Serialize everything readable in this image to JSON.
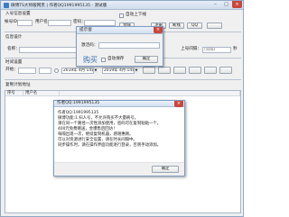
{
  "window": {
    "title": "微博TS大师版网页 | 作者QQ1991995135 - 测试版",
    "minimize": "–",
    "maximize": "□",
    "close": "×"
  },
  "account": {
    "group_label": "入号信息设置",
    "acc_label": "帐号ID：",
    "user_label": "用户名：",
    "pwd_label": "密码：",
    "checkbox_label": "自动上下线",
    "login_button": "登陆",
    "register_button": "注册",
    "lower_button": "断线",
    "qq_button": "QQ"
  },
  "config": {
    "group_label": "信息设计",
    "name_label": "名称：",
    "line_value": "",
    "upper_limit_label": "上号间隔：",
    "upper_limit_value": "(间隔)",
    "seconds_label": "秒"
  },
  "time": {
    "group_label": "时间设置",
    "start_label": "开始：",
    "start_value": "2019年 4月 14日",
    "end_value": "2019年 4月 14日",
    "radio_label": "任务"
  },
  "list": {
    "group_label": "复制计划地址",
    "columns": [
      "序号",
      "用户名"
    ]
  },
  "popup": {
    "title": "提示窗",
    "field_label": "激活码：",
    "button_label": "确定",
    "checkbox_label": "自动保存",
    "brand_text": "购买"
  },
  "message": {
    "title": "作者QQ:1991995135",
    "lines": [
      "作者QQ:1991995135",
      "微博功能:1.扫人号，不允许购买不大量刷号。",
      "请在同一个路径一次性添加使用，密码可在复制粘贴一个。",
      "400元免费赠送，金爆售后回访！",
      "每隔出现一次，继续复制机器，感谢惠顾。",
      "可以对资源进行安全设置，请在时长间隔中。",
      "同步操作时，请在操作界面功能进行登录，否则手动添加。"
    ],
    "ok_button": "确定"
  }
}
